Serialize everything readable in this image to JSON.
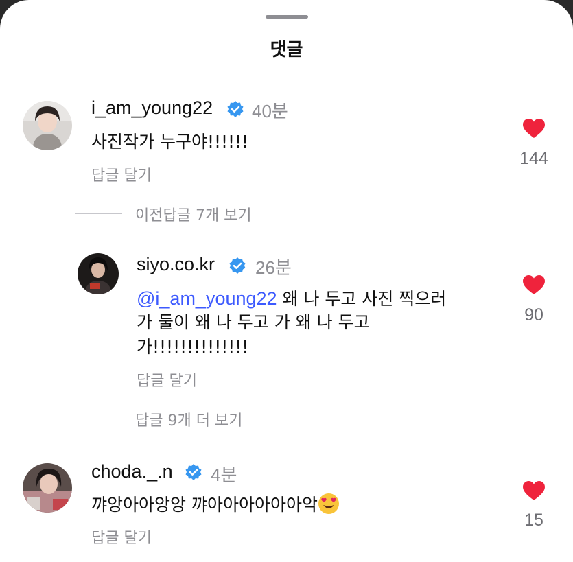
{
  "sheet": {
    "title": "댓글"
  },
  "comments": [
    {
      "username": "i_am_young22",
      "verified": true,
      "time": "40분",
      "text": "사진작가 누구야!!!!!!",
      "reply_label": "답글 달기",
      "likes": "144"
    },
    {
      "username": "siyo.co.kr",
      "verified": true,
      "time": "26분",
      "mention": "@i_am_young22",
      "text_line1_rest": " 왜 나 두고 사진 찍으러",
      "text_line2": "가 둘이 왜 나 두고 가 왜 나 두고",
      "text_line3": "가!!!!!!!!!!!!!!",
      "reply_label": "답글 달기",
      "likes": "90"
    },
    {
      "username": "choda._.n",
      "verified": true,
      "time": "4분",
      "text": "꺄앙아아앙앙 꺄아아아아아아악",
      "emoji": "heart-eyes-emoji",
      "reply_label": "답글 달기",
      "likes": "15"
    }
  ],
  "threads": {
    "previous_replies": "이전답글 7개 보기",
    "more_replies": "답글 9개 더 보기"
  },
  "colors": {
    "heart": "#ef233c",
    "verified": "#3797f0",
    "mention": "#3d5afe",
    "muted": "#8e8e93"
  }
}
